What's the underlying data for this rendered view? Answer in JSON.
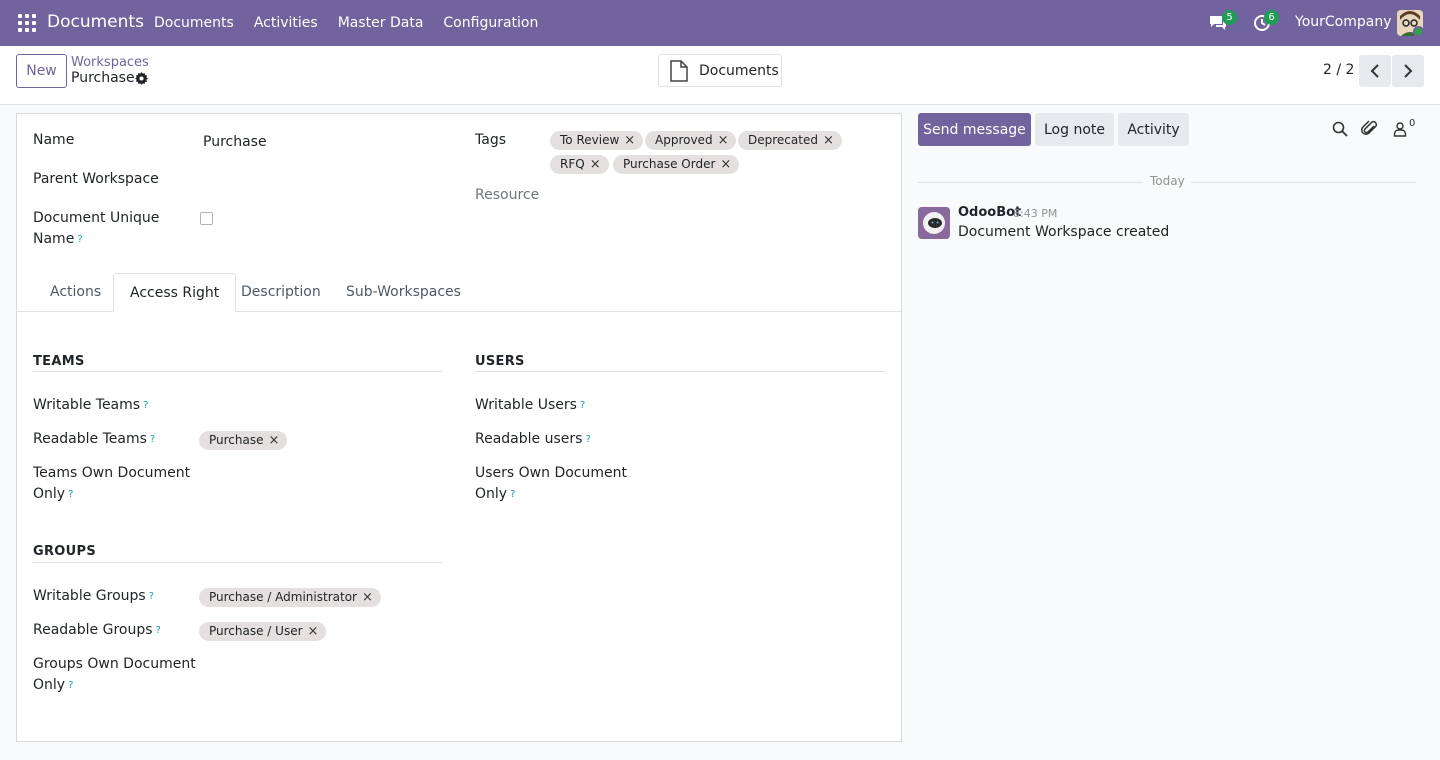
{
  "navbar": {
    "brand": "Documents",
    "menu": [
      "Documents",
      "Activities",
      "Master Data",
      "Configuration"
    ],
    "messages_count": "5",
    "activities_count": "6",
    "company": "YourCompany"
  },
  "control_panel": {
    "new_label": "New",
    "breadcrumb_parent": "Workspaces",
    "breadcrumb_current": "Purchase",
    "documents_button": "Documents",
    "pager": "2 / 2"
  },
  "form": {
    "name_label": "Name",
    "name_value": "Purchase",
    "parent_label": "Parent Workspace",
    "unique_label_1": "Document Unique",
    "unique_label_2": "Name",
    "tags_label": "Tags",
    "tags": [
      "To Review",
      "Approved",
      "Deprecated",
      "RFQ",
      "Purchase Order"
    ],
    "resource_label": "Resource",
    "tabs": [
      "Actions",
      "Access Right",
      "Description",
      "Sub-Workspaces"
    ],
    "teams": {
      "title": "TEAMS",
      "writable_label": "Writable Teams",
      "readable_label": "Readable Teams",
      "readable_tag": "Purchase",
      "own_label_1": "Teams Own Document",
      "own_label_2": "Only"
    },
    "users": {
      "title": "USERS",
      "writable_label": "Writable Users",
      "readable_label": "Readable users",
      "own_label_1": "Users Own Document",
      "own_label_2": "Only"
    },
    "groups": {
      "title": "GROUPS",
      "writable_label": "Writable Groups",
      "writable_tag": "Purchase / Administrator",
      "readable_label": "Readable Groups",
      "readable_tag": "Purchase / User",
      "own_label_1": "Groups Own Document",
      "own_label_2": "Only"
    },
    "help_mark": "?",
    "remove_mark": "×"
  },
  "chatter": {
    "send_message": "Send message",
    "log_note": "Log note",
    "activity": "Activity",
    "followers_count": "0",
    "date_separator": "Today",
    "message": {
      "author": "OdooBot",
      "time": "8:43 PM",
      "body": "Document Workspace created"
    }
  },
  "colors": {
    "brand": "#71639e",
    "badge": "#1e9e54",
    "tag_bg": "#e5e0e0"
  }
}
